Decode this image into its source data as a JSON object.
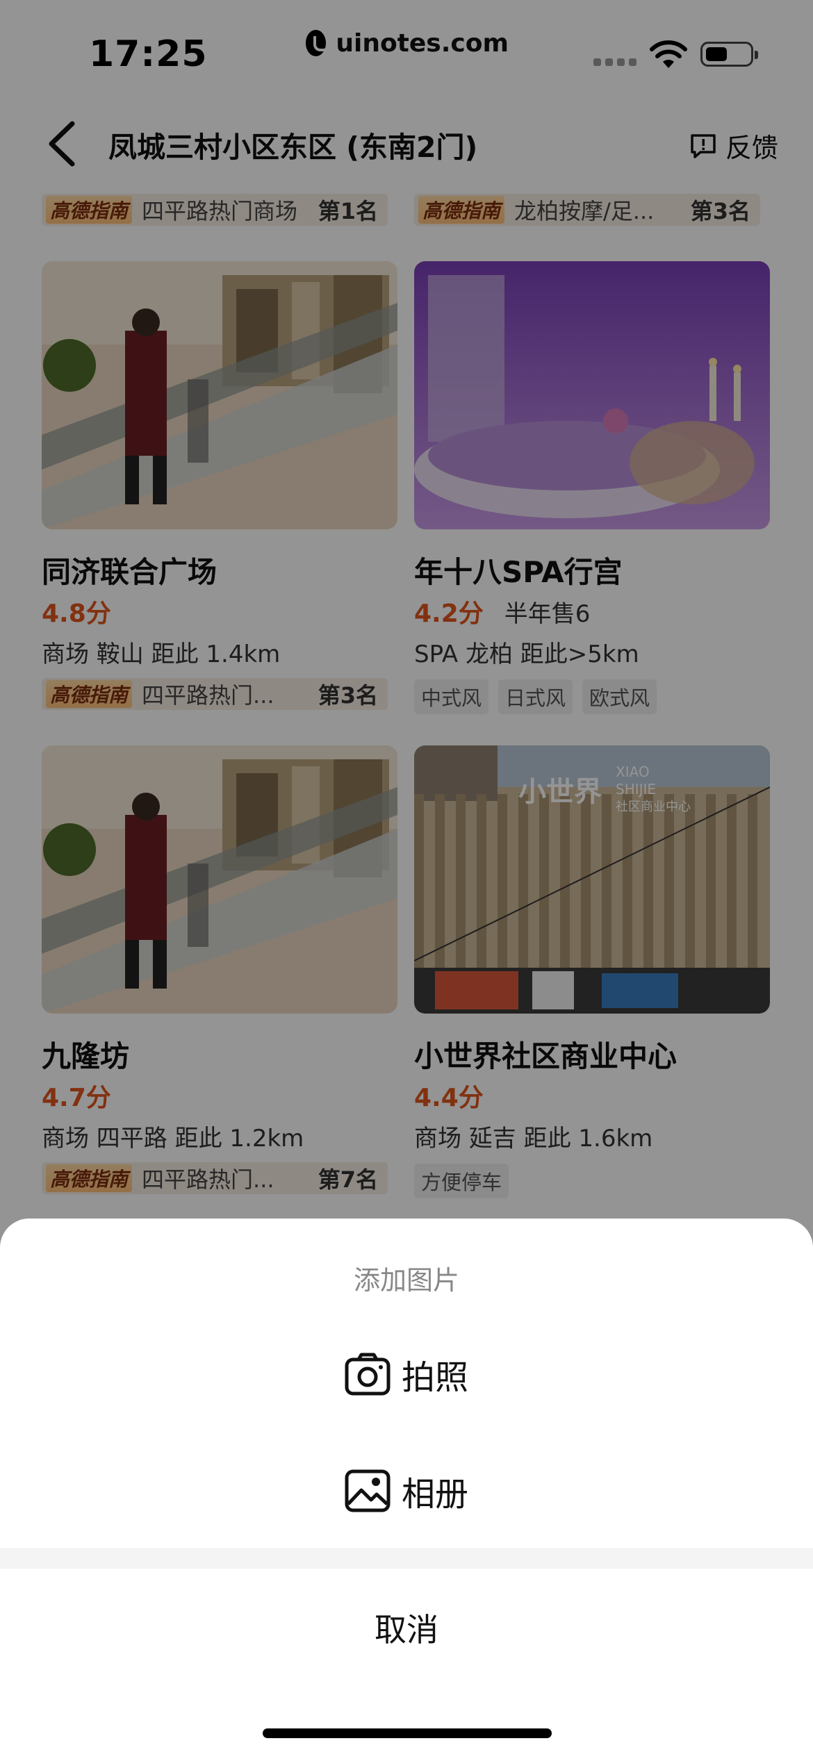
{
  "status_bar": {
    "time": "17:25",
    "pill_text": "uinotes.com"
  },
  "nav": {
    "title": "凤城三村小区东区 (东南2门)",
    "feedback": "反馈"
  },
  "top_ranks": [
    {
      "badge": "高德指南",
      "text": "四平路热门商场",
      "rank": "第1名"
    },
    {
      "badge": "高德指南",
      "text": "龙柏按摩/足...",
      "rank": "第3名"
    }
  ],
  "cards": [
    {
      "name": "同济联合广场",
      "score": "4.8分",
      "sales": "",
      "meta": "商场   鞍山   距此 1.4km",
      "rank": {
        "badge": "高德指南",
        "text": "四平路热门...",
        "rank": "第3名"
      },
      "tags": []
    },
    {
      "name": "年十八SPA行宫",
      "score": "4.2分",
      "sales": "半年售6",
      "meta": "SPA   龙柏   距此>5km",
      "rank": null,
      "tags": [
        "中式风",
        "日式风",
        "欧式风"
      ]
    },
    {
      "name": "九隆坊",
      "score": "4.7分",
      "sales": "",
      "meta": "商场   四平路   距此 1.2km",
      "rank": {
        "badge": "高德指南",
        "text": "四平路热门...",
        "rank": "第7名"
      },
      "tags": []
    },
    {
      "name": "小世界社区商业中心",
      "score": "4.4分",
      "sales": "",
      "meta": "商场   延吉   距此 1.6km",
      "rank": null,
      "tags": [
        "方便停车"
      ]
    }
  ],
  "store_sign": {
    "cn": "小世界",
    "en_top": "XIAO",
    "en_bottom": "SHIJIE",
    "sub": "社区商业中心"
  },
  "sheet": {
    "title": "添加图片",
    "camera": "拍照",
    "album": "相册",
    "cancel": "取消"
  }
}
